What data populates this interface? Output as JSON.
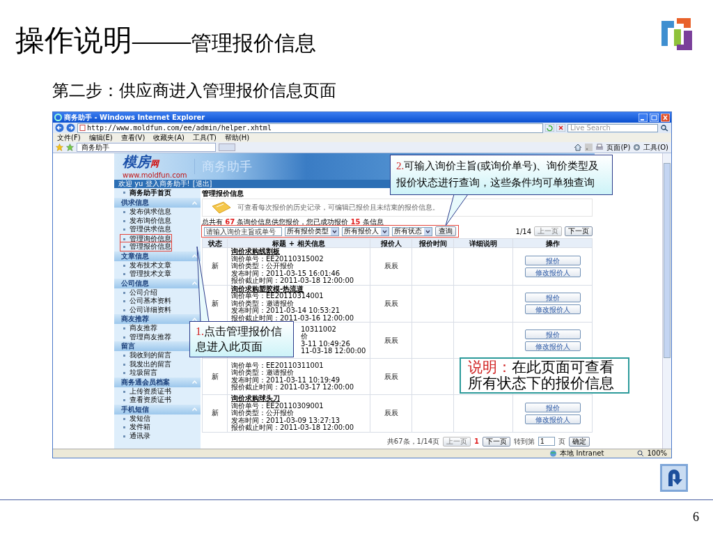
{
  "heading": "操作说明——",
  "heading_topic": "管理报价信息",
  "step_title": "第二步：供应商进入管理报价信息页面",
  "browser": {
    "title": "商务助手 - Windows Internet Explorer",
    "url": "http://www.moldfun.com/ee/admin/helper.xhtml",
    "search_placeholder": "Live Search",
    "menu": [
      "文件(F)",
      "编辑(E)",
      "查看(V)",
      "收藏夹(A)",
      "工具(T)",
      "帮助(H)"
    ],
    "tab": "商务助手",
    "toolbar": [
      "页面(P)",
      "工具(O)"
    ],
    "status_zone": "本地 Intranet",
    "zoom": "100%"
  },
  "site": {
    "logo": "模房",
    "logo_suffix": "网",
    "logo_url": "www.moldfun.com",
    "app_name": "商务助手",
    "welcome": "欢迎 yu 登入商务助手!",
    "logout": "[退出]",
    "sidebar": {
      "home": "商务助手首页",
      "groups": [
        {
          "title": "供求信息",
          "items": [
            {
              "label": "发布供求信息",
              "highlighted": false
            },
            {
              "label": "发布询价信息",
              "highlighted": false
            },
            {
              "label": "管理供求信息",
              "highlighted": false
            },
            {
              "label": "管理询价信息",
              "highlighted": true
            },
            {
              "label": "管理报价信息",
              "highlighted": true
            }
          ]
        },
        {
          "title": "文章信息",
          "items": [
            {
              "label": "发布技术文章",
              "highlighted": false
            },
            {
              "label": "管理技术文章",
              "highlighted": false
            }
          ]
        },
        {
          "title": "公司信息",
          "items": [
            {
              "label": "公司介绍",
              "highlighted": false
            },
            {
              "label": "公司基本资料",
              "highlighted": false
            },
            {
              "label": "公司详细资料",
              "highlighted": false
            }
          ]
        },
        {
          "title": "商友推荐",
          "items": [
            {
              "label": "商友推荐",
              "highlighted": false
            },
            {
              "label": "管理商友推荐",
              "highlighted": false
            }
          ]
        },
        {
          "title": "留言",
          "items": [
            {
              "label": "我收到的留言",
              "highlighted": false
            },
            {
              "label": "我发出的留言",
              "highlighted": false
            },
            {
              "label": "垃圾留言",
              "highlighted": false
            }
          ]
        },
        {
          "title": "商务通会员档案",
          "items": [
            {
              "label": "上传资质证书",
              "highlighted": false
            },
            {
              "label": "查看资质证书",
              "highlighted": false
            }
          ]
        },
        {
          "title": "手机短信",
          "items": [
            {
              "label": "发短信",
              "highlighted": false
            },
            {
              "label": "发件箱",
              "highlighted": false
            },
            {
              "label": "通讯录",
              "highlighted": false
            }
          ]
        }
      ]
    },
    "main": {
      "title": "管理报价信息",
      "description": "可查看每次报价的历史记录，可编辑已报价且未结束的报价信息。",
      "summary": "总共有 **67** 条询价信息供您报价，您已成功报价 **15** 条信息",
      "filter": {
        "highlighted": true,
        "placeholder": "请输入询价主旨或单号",
        "selects": [
          "所有报价类型",
          "所有报价人",
          "所有状态"
        ],
        "button": "查询"
      },
      "pager_top": {
        "position": "1/14",
        "prev": {
          "label": "上一页",
          "disabled": true
        },
        "next": {
          "label": "下一页",
          "disabled": false
        }
      },
      "columns": [
        "状态",
        "标题 + 相关信息",
        "报价人",
        "报价时间",
        "详细说明",
        "操作"
      ],
      "rows": [
        {
          "kind": "plain",
          "status": "新",
          "title": "询价求购线割板",
          "lines": [
            "询价单号：EE20110315002",
            "询价类型：公开报价",
            "发布时间：2011-03-15 16:01:46",
            "报价截止时间：2011-03-18 12:00:00"
          ],
          "quoter": "辰辰",
          "actions": [
            "报价",
            "修改报价人"
          ]
        },
        {
          "kind": "plain",
          "status": "新",
          "title": "询价求购塑胶模-热流道",
          "lines": [
            "询价单号：EE20110314001",
            "询价类型：邀请报价",
            "发布时间：2011-03-14 10:53:21",
            "报价截止时间：2011-03-16 12:00:00"
          ],
          "quoter": "辰辰",
          "actions": [
            "报价",
            "修改报价人"
          ]
        },
        {
          "kind": "covered",
          "lines": [
            "10311002",
            "价",
            "3-11 10:49:26",
            "11-03-18 12:00:00"
          ],
          "quoter": "辰辰",
          "actions": [
            "报价",
            "修改报价人"
          ]
        },
        {
          "kind": "plain",
          "status": "新",
          "lines": [
            "询价单号：EE20110311001",
            "询价类型：邀请报价",
            "发布时间：2011-03-11 10:19:49",
            "报价截止时间：2011-03-17 12:00:00"
          ],
          "quoter": "辰辰"
        },
        {
          "kind": "plain",
          "status": "新",
          "title": "询价求购球头刀",
          "lines": [
            "询价单号：EE20110309001",
            "询价类型：公开报价",
            "发布时间：2011-03-09 13:27:13",
            "报价截止时间：2011-03-18 12:00:00"
          ],
          "quoter": "辰辰",
          "actions": [
            "报价",
            "修改报价人"
          ]
        }
      ],
      "pager": {
        "total": "共67条，1/14页",
        "prev": {
          "label": "上一页",
          "disabled": true
        },
        "current": "1",
        "next": {
          "label": "下一页",
          "disabled": false
        },
        "goto": "转到第",
        "page_value": "1",
        "page_unit": "页",
        "confirm": "确定"
      }
    }
  },
  "callouts": [
    {
      "kind": "step",
      "number": "1.",
      "text": "点击管理报价信息进入此页面"
    },
    {
      "kind": "step",
      "number": "2.",
      "text": "可输入询价主旨(或询价单号)、询价类型及报价状态进行查询，这些条件均可单独查询"
    },
    {
      "kind": "note",
      "number": "说明：",
      "text": "在此页面可查看所有状态下的报价信息"
    }
  ],
  "page_number": "6"
}
